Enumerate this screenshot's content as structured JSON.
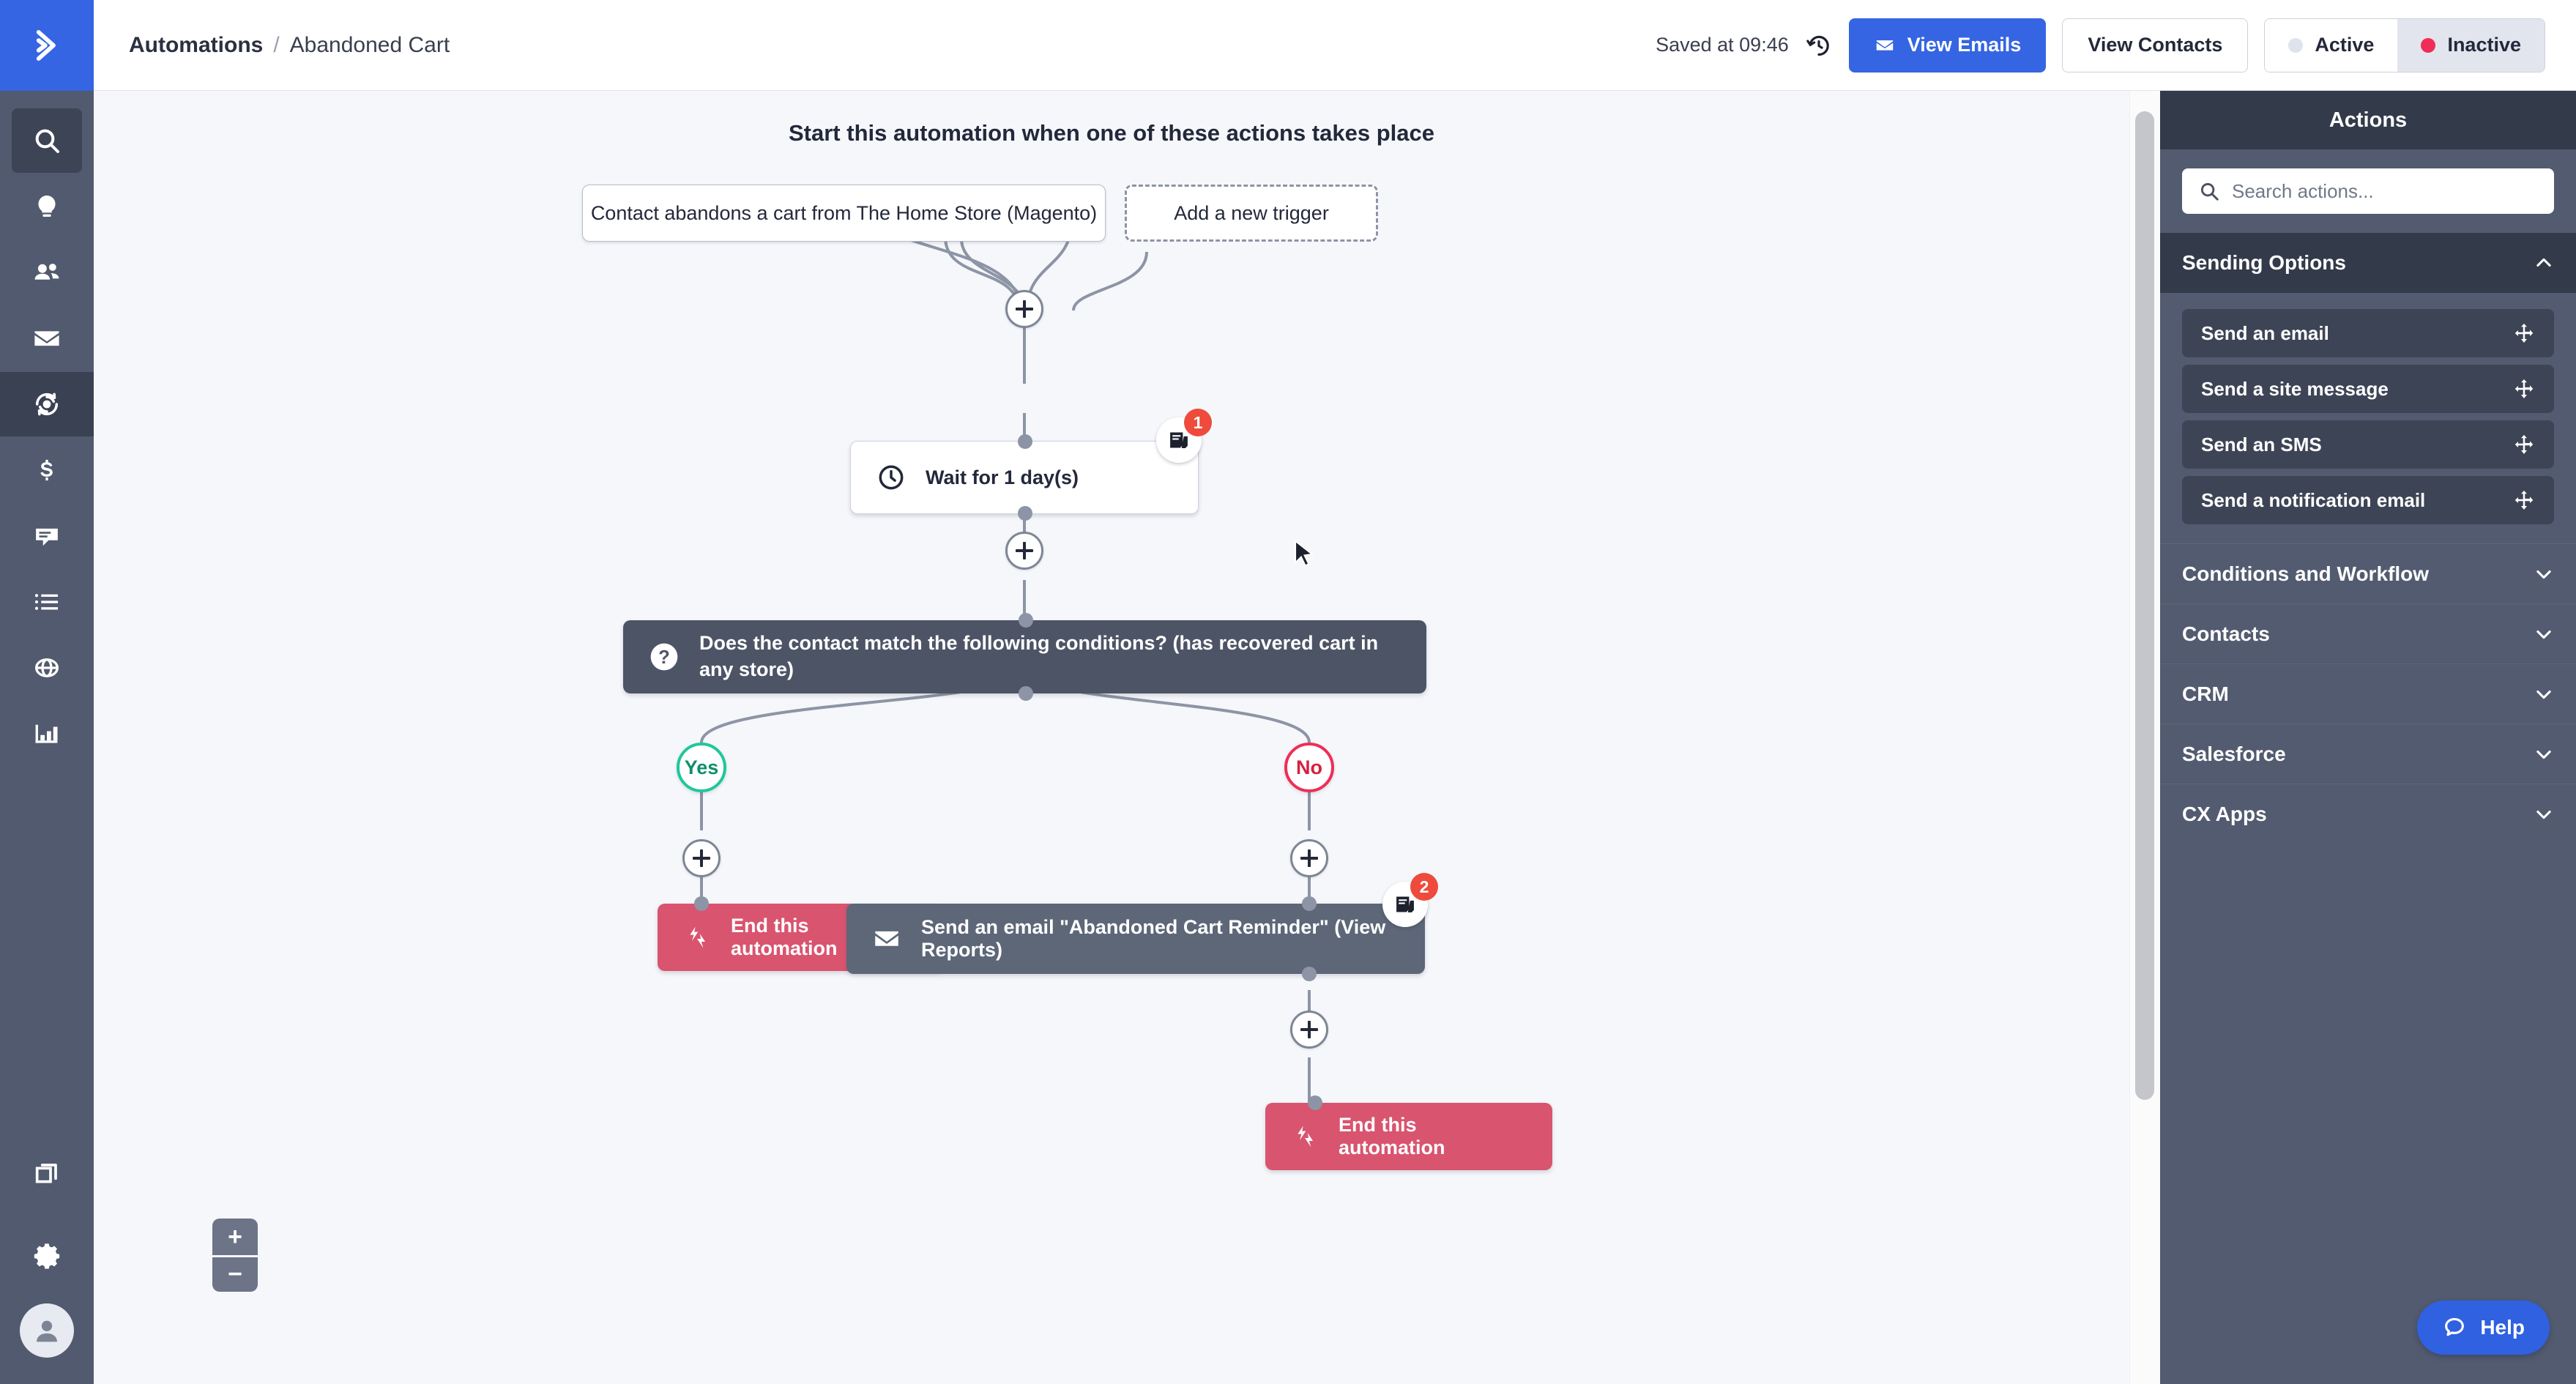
{
  "app": {
    "logo_icon": "chevron-right-logo",
    "accent_blue": "#3565e3",
    "rail_bg": "#515a6e"
  },
  "header": {
    "breadcrumb_root": "Automations",
    "breadcrumb_separator": "/",
    "breadcrumb_leaf": "Abandoned Cart",
    "saved_text": "Saved at 09:46",
    "history_icon": "history-revert-icon",
    "view_emails_label": "View Emails",
    "view_emails_icon": "envelope-icon",
    "view_contacts_label": "View Contacts",
    "state_active_label": "Active",
    "state_inactive_label": "Inactive",
    "state_active_dot_color": "#dfe3ec",
    "state_inactive_dot_color": "#ef2d56",
    "state_selected": "Inactive"
  },
  "sidebar": {
    "items": [
      {
        "icon": "search-icon",
        "name": "search",
        "selected": true
      },
      {
        "icon": "lightbulb-icon",
        "name": "campaigns",
        "selected": false
      },
      {
        "icon": "contacts-icon",
        "name": "contacts",
        "selected": false
      },
      {
        "icon": "envelope-icon",
        "name": "email",
        "selected": false
      },
      {
        "icon": "automation-gear-cycle-icon",
        "name": "automations",
        "selected": true
      },
      {
        "icon": "dollar-icon",
        "name": "deals",
        "selected": false
      },
      {
        "icon": "chat-bubble-icon",
        "name": "conversations",
        "selected": false
      },
      {
        "icon": "list-icon",
        "name": "lists",
        "selected": false
      },
      {
        "icon": "globe-icon",
        "name": "website",
        "selected": false
      },
      {
        "icon": "bar-chart-icon",
        "name": "reports",
        "selected": false
      }
    ],
    "bottom_items": [
      {
        "icon": "copy-stack-icon",
        "name": "apps"
      },
      {
        "icon": "gear-icon",
        "name": "settings"
      },
      {
        "icon": "user-avatar-icon",
        "name": "account"
      }
    ]
  },
  "canvas": {
    "flow_title": "Start this automation when one of these actions takes place",
    "triggers": [
      {
        "label": "Contact abandons a cart from The Home Store (Magento)",
        "style": "solid"
      },
      {
        "label": "Add a new trigger",
        "style": "dashed"
      }
    ],
    "nodes": [
      {
        "id": "wait",
        "label": "Wait for 1 day(s)",
        "icon": "clock-icon",
        "style": "white",
        "badge_count": "1",
        "badge_icon": "contacts-note-icon"
      },
      {
        "id": "condition",
        "label": "Does the contact match the following conditions? (has recovered cart in any store)",
        "icon": "question-mark-icon",
        "style": "dark"
      },
      {
        "id": "end-yes",
        "label": "End this automation",
        "icon": "end-automation-icon",
        "style": "pink"
      },
      {
        "id": "send-email",
        "label": "Send an email \"Abandoned Cart Reminder\" (View Reports)",
        "icon": "envelope-icon",
        "style": "slate",
        "badge_count": "2",
        "badge_icon": "contacts-note-icon"
      },
      {
        "id": "end-no",
        "label": "End this automation",
        "icon": "end-automation-icon",
        "style": "pink"
      }
    ],
    "branches": [
      {
        "label": "Yes",
        "color": "#1fc79a"
      },
      {
        "label": "No",
        "color": "#ef2d56"
      }
    ],
    "add_step_label": "+",
    "zoom_in_label": "+",
    "zoom_out_label": "−"
  },
  "right_panel": {
    "title": "Actions",
    "search_placeholder": "Search actions...",
    "search_value": "",
    "search_icon": "search-icon",
    "groups": [
      {
        "label": "Sending Options",
        "expanded": true,
        "chevron": "chevron-up-icon",
        "items": [
          {
            "label": "Send an email",
            "handle_icon": "drag-move-icon"
          },
          {
            "label": "Send a site message",
            "handle_icon": "drag-move-icon"
          },
          {
            "label": "Send an SMS",
            "handle_icon": "drag-move-icon"
          },
          {
            "label": "Send a notification email",
            "handle_icon": "drag-move-icon"
          }
        ]
      },
      {
        "label": "Conditions and Workflow",
        "expanded": false,
        "chevron": "chevron-down-icon",
        "items": []
      },
      {
        "label": "Contacts",
        "expanded": false,
        "chevron": "chevron-down-icon",
        "items": []
      },
      {
        "label": "CRM",
        "expanded": false,
        "chevron": "chevron-down-icon",
        "items": []
      },
      {
        "label": "Salesforce",
        "expanded": false,
        "chevron": "chevron-down-icon",
        "items": []
      },
      {
        "label": "CX Apps",
        "expanded": false,
        "chevron": "chevron-down-icon",
        "items": []
      }
    ]
  },
  "help": {
    "label": "Help",
    "icon": "chat-bubble-icon"
  }
}
